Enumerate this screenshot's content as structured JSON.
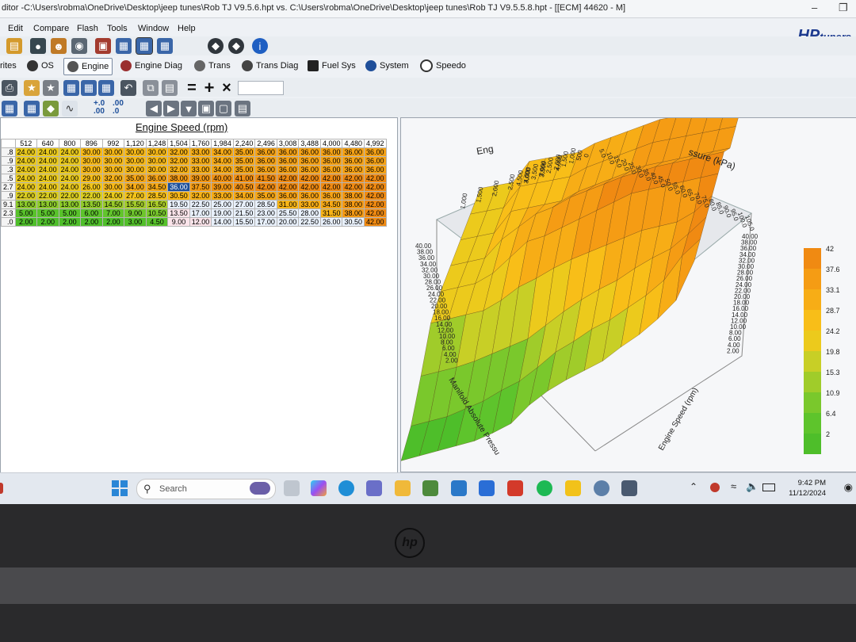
{
  "window": {
    "title": "ditor -C:\\Users\\robma\\OneDrive\\Desktop\\jeep tunes\\Rob TJ V9.5.6.hpt vs. C:\\Users\\robma\\OneDrive\\Desktop\\jeep tunes\\Rob TJ V9.5.5.8.hpt - [[ECM] 44620 - M]",
    "logo": "HP",
    "logo_suffix": "tuners"
  },
  "menu": [
    "Edit",
    "Compare",
    "Flash",
    "Tools",
    "Window",
    "Help"
  ],
  "tabs": [
    {
      "label": "rites",
      "icon": "none"
    },
    {
      "label": "OS",
      "icon": "chip-icon"
    },
    {
      "label": "Engine",
      "icon": "engine-icon",
      "active": true
    },
    {
      "label": "Engine Diag",
      "icon": "engine-diag-icon"
    },
    {
      "label": "Trans",
      "icon": "gear-icon"
    },
    {
      "label": "Trans Diag",
      "icon": "gear-diag-icon"
    },
    {
      "label": "Fuel Sys",
      "icon": "fuel-pump-icon"
    },
    {
      "label": "System",
      "icon": "system-icon"
    },
    {
      "label": "Speedo",
      "icon": "speedometer-icon"
    }
  ],
  "table": {
    "title": "Engine Speed (rpm)",
    "columns": [
      "512",
      "640",
      "800",
      "896",
      "992",
      "1,120",
      "1,248",
      "1,504",
      "1,760",
      "1,984",
      "2,240",
      "2,496",
      "3,008",
      "3,488",
      "4,000",
      "4,480",
      "4,992"
    ],
    "row_labels": [
      ".8",
      ".9",
      ".3",
      ".5",
      "2.7",
      ".9",
      "9.1",
      "2.3",
      ".0"
    ],
    "rows": [
      [
        "24.00",
        "24.00",
        "24.00",
        "30.00",
        "30.00",
        "30.00",
        "30.00",
        "32.00",
        "33.00",
        "34.00",
        "35.00",
        "36.00",
        "36.00",
        "36.00",
        "36.00",
        "36.00",
        "36.00"
      ],
      [
        "24.00",
        "24.00",
        "24.00",
        "30.00",
        "30.00",
        "30.00",
        "30.00",
        "32.00",
        "33.00",
        "34.00",
        "35.00",
        "36.00",
        "36.00",
        "36.00",
        "36.00",
        "36.00",
        "36.00"
      ],
      [
        "24.00",
        "24.00",
        "24.00",
        "30.00",
        "30.00",
        "30.00",
        "30.00",
        "32.00",
        "33.00",
        "34.00",
        "35.00",
        "36.00",
        "36.00",
        "36.00",
        "36.00",
        "36.00",
        "36.00"
      ],
      [
        "24.00",
        "24.00",
        "24.00",
        "29.00",
        "32.00",
        "35.00",
        "36.00",
        "38.00",
        "39.00",
        "40.00",
        "41.00",
        "41.50",
        "42.00",
        "42.00",
        "42.00",
        "42.00",
        "42.00"
      ],
      [
        "24.00",
        "24.00",
        "24.00",
        "26.00",
        "30.00",
        "34.00",
        "34.50",
        "36.00",
        "37.50",
        "39.00",
        "40.50",
        "42.00",
        "42.00",
        "42.00",
        "42.00",
        "42.00",
        "42.00"
      ],
      [
        "22.00",
        "22.00",
        "22.00",
        "22.00",
        "24.00",
        "27.00",
        "28.50",
        "30.50",
        "32.00",
        "33.00",
        "34.00",
        "35.00",
        "36.00",
        "36.00",
        "36.00",
        "38.00",
        "42.00"
      ],
      [
        "13.00",
        "13.00",
        "13.00",
        "13.50",
        "14.50",
        "15.50",
        "16.50",
        "19.50",
        "22.50",
        "25.00",
        "27.00",
        "28.50",
        "31.00",
        "33.00",
        "34.50",
        "38.00",
        "42.00"
      ],
      [
        "5.00",
        "5.00",
        "5.00",
        "6.00",
        "7.00",
        "9.00",
        "10.50",
        "13.50",
        "17.00",
        "19.00",
        "21.50",
        "23.00",
        "25.50",
        "28.00",
        "31.50",
        "38.00",
        "42.00"
      ],
      [
        "2.00",
        "2.00",
        "2.00",
        "2.00",
        "2.00",
        "3.00",
        "4.50",
        "9.00",
        "12.00",
        "14.00",
        "15.50",
        "17.00",
        "20.00",
        "22.50",
        "26.00",
        "30.50",
        "42.00"
      ]
    ],
    "selected_cell": {
      "row": 4,
      "col": 7
    }
  },
  "surface": {
    "y_axis_label": "Engine Speed (rpm)",
    "x_axis_label": "Manifold Absolute Pressu",
    "top_axis_label": "ssure (kPa)",
    "left_top_label": "Eng",
    "kpa_ticks": [
      "5.0",
      "10.0",
      "15.0",
      "20.0",
      "25.0",
      "30.0",
      "35.0",
      "40.0",
      "45.0",
      "50.0",
      "55.0",
      "60.0",
      "65.0",
      "70.0",
      "75.0",
      "80.0",
      "85.0",
      "90.0",
      "95.0",
      "100.0",
      "105.0"
    ],
    "rpm_ticks": [
      "0",
      "500",
      "1,000",
      "1,500",
      "2,000",
      "2,500",
      "3,000",
      "3,500",
      "4,000",
      "4,500"
    ],
    "left_rpm_ticks": [
      "1,000",
      "1,500",
      "2,000",
      "2,500",
      "3,000",
      "3,500",
      "4,000"
    ],
    "z_ticks": [
      "40.00",
      "38.00",
      "36.00",
      "34.00",
      "32.00",
      "30.00",
      "28.00",
      "26.00",
      "24.00",
      "22.00",
      "20.00",
      "18.00",
      "16.00",
      "14.00",
      "12.00",
      "10.00",
      "8.00",
      "6.00",
      "4.00",
      "2.00"
    ],
    "legend": [
      "42",
      "37.6",
      "33.1",
      "28.7",
      "24.2",
      "19.8",
      "15.3",
      "10.9",
      "6.4",
      "2"
    ],
    "legend_colors": [
      "#f08a12",
      "#f59c14",
      "#f7ad16",
      "#f8be18",
      "#ecca1c",
      "#c8cf26",
      "#a0cc2a",
      "#7ac82c",
      "#5ec42c",
      "#4ebe2a"
    ]
  },
  "taskbar": {
    "search_placeholder": "Search",
    "time": "9:42 PM",
    "date": "11/12/2024"
  },
  "laptop": {
    "brand": "hp"
  }
}
